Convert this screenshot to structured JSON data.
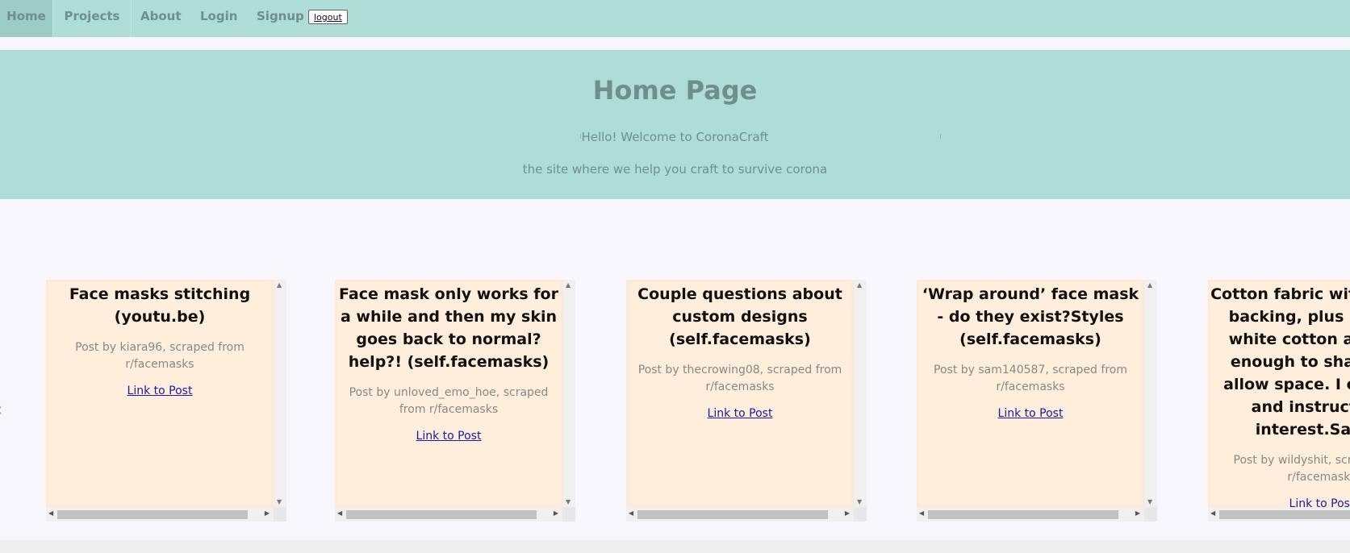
{
  "nav": {
    "home": "Home",
    "projects": "Projects",
    "about": "About",
    "login": "Login",
    "signup": "Signup",
    "logout": "logout"
  },
  "hero": {
    "title": "Home Page",
    "welcome": "Hello! Welcome to CoronaCraft",
    "tagline": "the site where we help you craft to survive corona"
  },
  "cards": [
    {
      "title": "Face masks stitching (youtu.be)",
      "author": "Post by kiara96, scraped from r/facemasks",
      "link": "Link to Post"
    },
    {
      "title": "Face mask only works for a while and then my skin goes back to normal?help?! (self.facemasks)",
      "author": "Post by unloved_emo_hoe, scraped from r/facemasks",
      "link": "Link to Post"
    },
    {
      "title": "Couple questions about custom designs (self.facemasks)",
      "author": "Post by thecrowing08, scraped from r/facemasks",
      "link": "Link to Post"
    },
    {
      "title": "‘Wrap around’ face mask - do they exist?Styles (self.facemasks)",
      "author": "Post by sam140587, scraped from r/facemasks",
      "link": "Link to Post"
    },
    {
      "title": "Cotton fabric with iron on backing, plus layer of white cotton and stiff enough to shape and allow space. I can post and instructions interest.Sales (",
      "author": "Post by wildyshit, scraped from r/facemasks",
      "link": "Link to Post"
    }
  ],
  "colors": {
    "nav_bg": "#aedcd6",
    "card_bg": "#ffeedb",
    "link": "#1a1aa6"
  }
}
